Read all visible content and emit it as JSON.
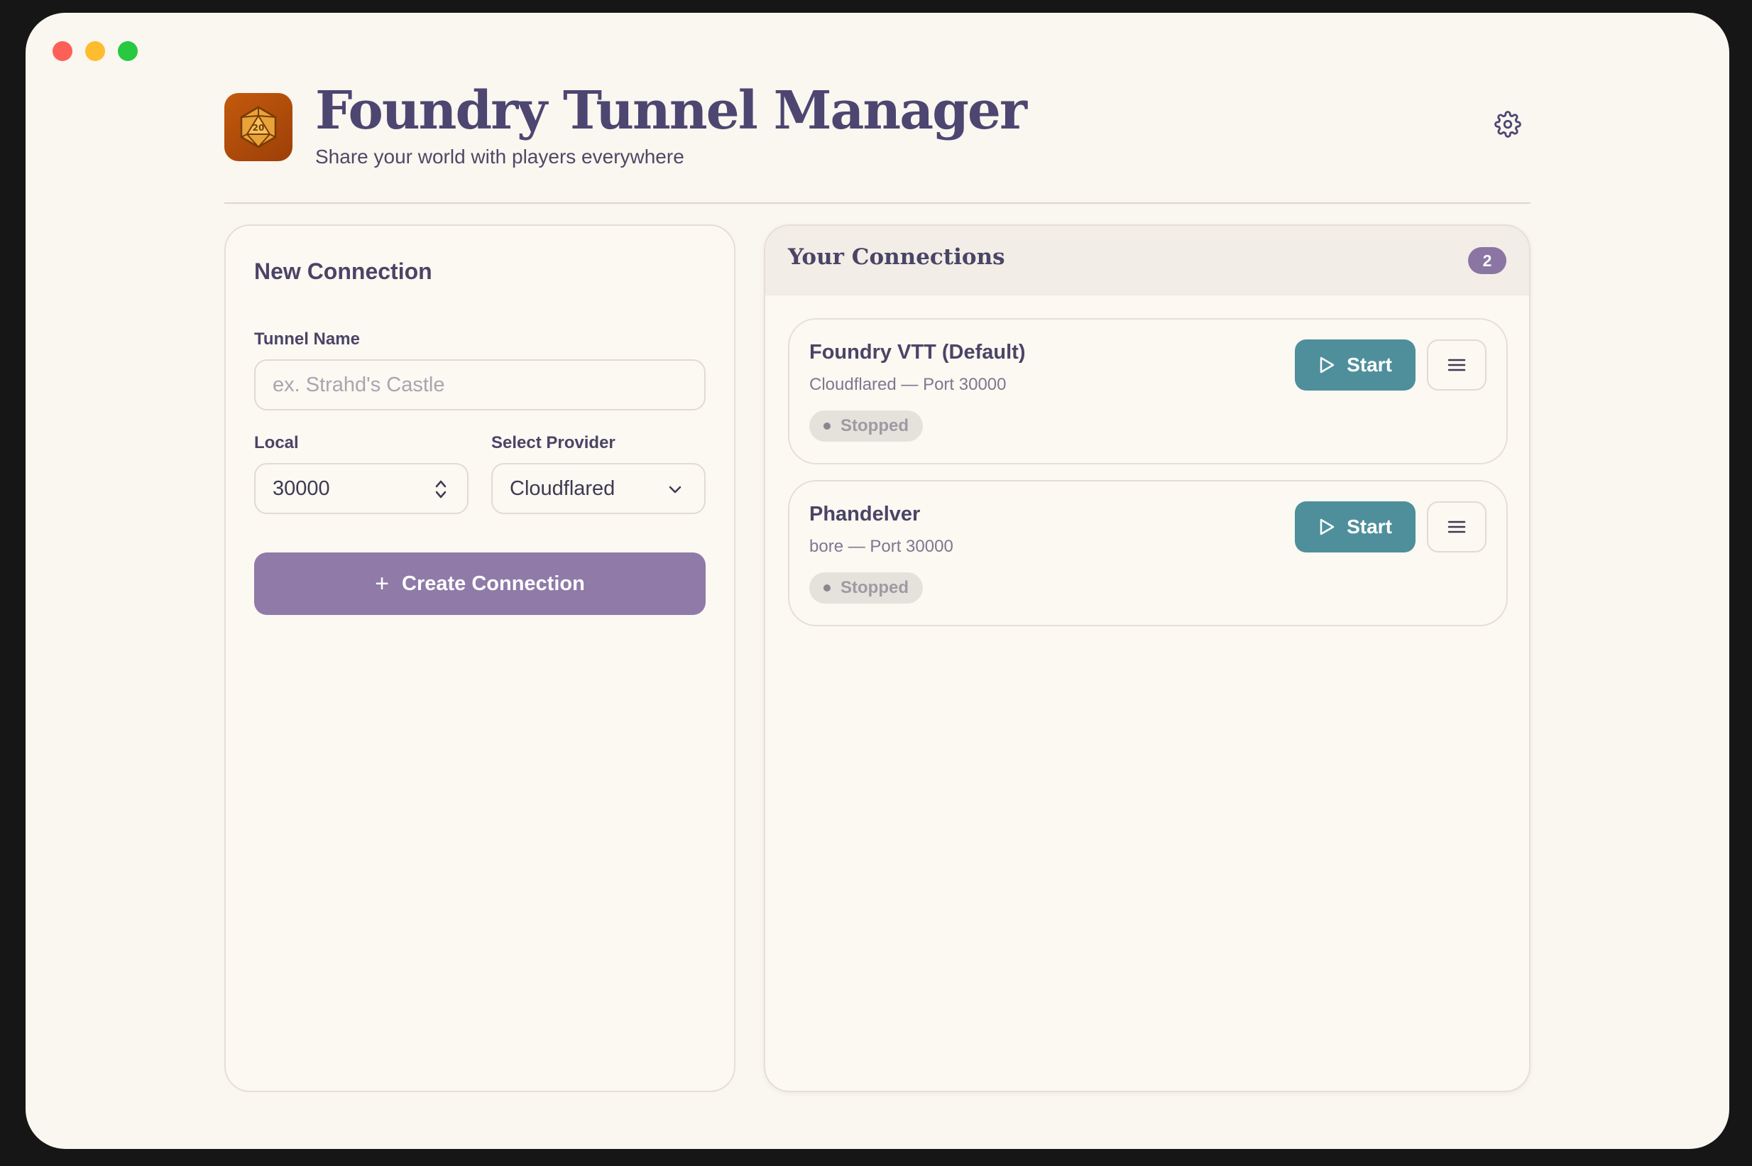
{
  "app": {
    "title": "Foundry Tunnel Manager",
    "subtitle": "Share your world with players everywhere",
    "logo_icon": "d20-dice-icon",
    "logo_text": "20"
  },
  "colors": {
    "accent_purple": "#8f7aa8",
    "start_teal": "#4f8f9c",
    "title_color": "#4c4670",
    "logo_orange": "#b24d0a"
  },
  "new_connection": {
    "title": "New Connection",
    "tunnel_name_label": "Tunnel Name",
    "tunnel_name_placeholder": "ex. Strahd's Castle",
    "tunnel_name_value": "",
    "local_label": "Local",
    "local_value": "30000",
    "provider_label": "Select Provider",
    "provider_value": "Cloudflared",
    "create_button": "Create Connection",
    "create_icon": "+"
  },
  "connections": {
    "title": "Your Connections",
    "count": "2",
    "items": [
      {
        "name": "Foundry VTT (Default)",
        "details": "Cloudflared — Port 30000",
        "status": "Stopped",
        "start_label": "Start"
      },
      {
        "name": "Phandelver",
        "details": "bore — Port 30000",
        "status": "Stopped",
        "start_label": "Start"
      }
    ]
  }
}
